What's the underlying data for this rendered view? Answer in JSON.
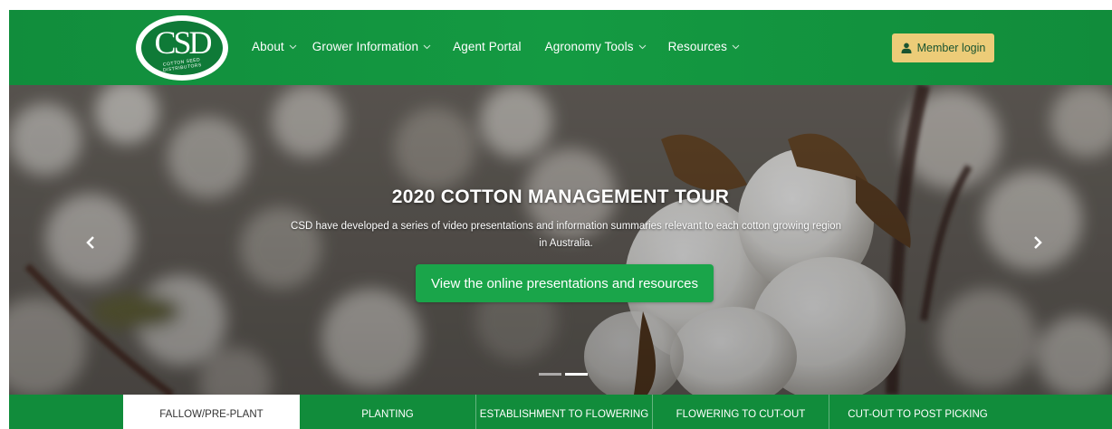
{
  "brand": {
    "logo_text": "CSD",
    "logo_subtext": "COTTON SEED DISTRIBUTORS",
    "primary_color": "#149a42",
    "button_color": "#1aa54a",
    "login_color": "#eccc78"
  },
  "nav": {
    "items": [
      {
        "label": "About",
        "has_dropdown": true
      },
      {
        "label": "Grower Information",
        "has_dropdown": true
      },
      {
        "label": "Agent Portal",
        "has_dropdown": false
      },
      {
        "label": "Agronomy Tools",
        "has_dropdown": true
      },
      {
        "label": "Resources",
        "has_dropdown": true
      }
    ],
    "login_label": "Member login",
    "login_icon": "user-icon"
  },
  "hero": {
    "title": "2020 COTTON MANAGEMENT TOUR",
    "description": "CSD have developed a series of video presentations and information summaries relevant to each cotton growing region in Australia.",
    "cta_label": "View the online presentations and resources",
    "prev_icon": "chevron-left-icon",
    "next_icon": "chevron-right-icon",
    "active_slide": 2,
    "slide_count": 2
  },
  "tabs": {
    "items": [
      {
        "label": "FALLOW/PRE-PLANT",
        "active": true
      },
      {
        "label": "PLANTING",
        "active": false
      },
      {
        "label": "ESTABLISHMENT TO FLOWERING",
        "active": false
      },
      {
        "label": "FLOWERING TO CUT-OUT",
        "active": false
      },
      {
        "label": "CUT-OUT TO POST PICKING",
        "active": false
      }
    ]
  }
}
